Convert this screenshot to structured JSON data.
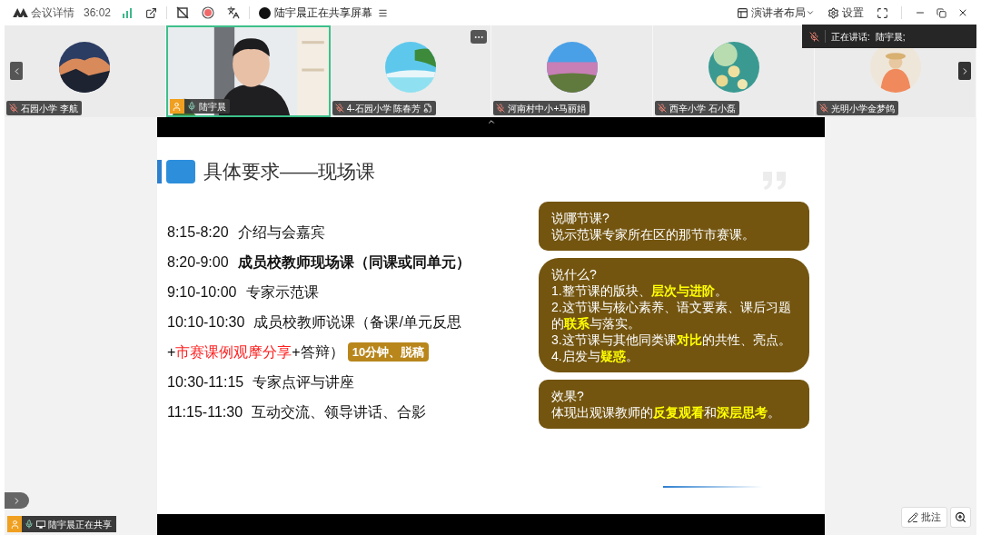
{
  "toolbar": {
    "meeting_details": "会议详情",
    "timer": "36:02",
    "sharing_status": "陆宇晨正在共享屏幕",
    "layout": "演讲者布局",
    "settings": "设置"
  },
  "participants": [
    {
      "name": "石园小学 李航",
      "muted": true,
      "host": false,
      "selected": false,
      "extra_icon": false,
      "kind": "avatar"
    },
    {
      "name": "陆宇晨",
      "muted": false,
      "host": true,
      "selected": true,
      "extra_icon": false,
      "kind": "video"
    },
    {
      "name": "4-石园小学 陈春芳",
      "muted": true,
      "host": false,
      "selected": false,
      "extra_icon": true,
      "kind": "avatar"
    },
    {
      "name": "河南村中小+马丽娟",
      "muted": true,
      "host": false,
      "selected": false,
      "extra_icon": false,
      "kind": "avatar"
    },
    {
      "name": "西辛小学 石小磊",
      "muted": true,
      "host": false,
      "selected": false,
      "extra_icon": false,
      "kind": "avatar"
    },
    {
      "name": "光明小学金梦鸽",
      "muted": true,
      "host": false,
      "selected": false,
      "extra_icon": false,
      "kind": "avatar"
    }
  ],
  "speaking": {
    "label": "正在讲话:",
    "name": "陆宇晨;"
  },
  "slide": {
    "title": "具体要求——现场课",
    "schedule": [
      {
        "kind": "slot",
        "time": "8:15-8:20",
        "segments": [
          {
            "text": "介绍与会嘉宾",
            "kind": "plain"
          }
        ]
      },
      {
        "kind": "slot",
        "time": "8:20-9:00",
        "segments": [
          {
            "text": "成员校教师现场课（同课或同单元）",
            "kind": "bold"
          }
        ]
      },
      {
        "kind": "slot",
        "time": "9:10-10:00",
        "segments": [
          {
            "text": "专家示范课",
            "kind": "plain"
          }
        ]
      },
      {
        "kind": "slot",
        "time": "10:10-10:30",
        "segments": [
          {
            "text": "成员校教师说课（备课/单元反思",
            "kind": "plain"
          }
        ]
      },
      {
        "kind": "continuation",
        "segments": [
          {
            "text": "+",
            "kind": "plain"
          },
          {
            "text": "市赛课例观摩分享",
            "kind": "red"
          },
          {
            "text": "+答辩）",
            "kind": "plain"
          }
        ],
        "badge": "10分钟、脱稿"
      },
      {
        "kind": "slot",
        "time": "10:30-11:15",
        "segments": [
          {
            "text": "专家点评与讲座",
            "kind": "plain"
          }
        ]
      },
      {
        "kind": "slot",
        "time": "11:15-11:30",
        "segments": [
          {
            "text": "互动交流、领导讲话、合影",
            "kind": "plain"
          }
        ]
      }
    ],
    "callouts": [
      {
        "heading": "说哪节课?",
        "lines": [
          [
            {
              "text": "说示范课专家所在区的那节市赛课。",
              "kind": "plain"
            }
          ]
        ]
      },
      {
        "heading": "说什么?",
        "lines": [
          [
            {
              "text": "1.整节课的版块、",
              "kind": "plain"
            },
            {
              "text": "层次与进阶",
              "kind": "highlight"
            },
            {
              "text": "。",
              "kind": "plain"
            }
          ],
          [
            {
              "text": "2.这节课与核心素养、语文要素、课后习题的",
              "kind": "plain"
            },
            {
              "text": "联系",
              "kind": "highlight"
            },
            {
              "text": "与落实。",
              "kind": "plain"
            }
          ],
          [
            {
              "text": "3.这节课与其他同类课",
              "kind": "plain"
            },
            {
              "text": "对比",
              "kind": "highlight"
            },
            {
              "text": "的共性、亮点。",
              "kind": "plain"
            }
          ],
          [
            {
              "text": "4.启发与",
              "kind": "plain"
            },
            {
              "text": "疑惑",
              "kind": "highlight"
            },
            {
              "text": "。",
              "kind": "plain"
            }
          ]
        ]
      },
      {
        "heading": "效果?",
        "lines": [
          [
            {
              "text": "体现出观课教师的",
              "kind": "plain"
            },
            {
              "text": "反复观看",
              "kind": "highlight"
            },
            {
              "text": "和",
              "kind": "plain"
            },
            {
              "text": "深层思考",
              "kind": "highlight"
            },
            {
              "text": "。",
              "kind": "plain"
            }
          ]
        ]
      }
    ]
  },
  "sharing_badge": "陆宇晨正在共享",
  "annotate_button": "批注"
}
